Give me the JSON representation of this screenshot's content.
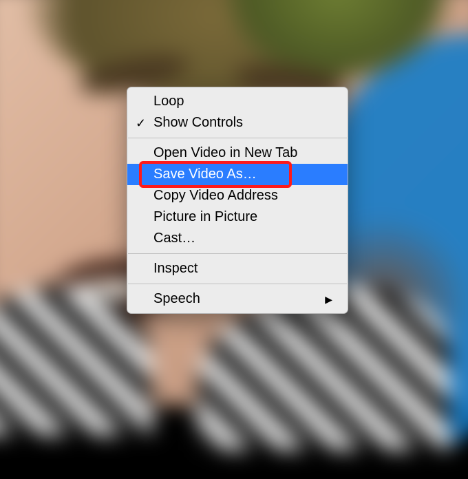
{
  "menu": {
    "items": [
      {
        "label": "Loop",
        "checked": false,
        "submenu": false
      },
      {
        "label": "Show Controls",
        "checked": true,
        "submenu": false
      },
      {
        "label": "Open Video in New Tab",
        "checked": false,
        "submenu": false
      },
      {
        "label": "Save Video As…",
        "checked": false,
        "submenu": false
      },
      {
        "label": "Copy Video Address",
        "checked": false,
        "submenu": false
      },
      {
        "label": "Picture in Picture",
        "checked": false,
        "submenu": false
      },
      {
        "label": "Cast…",
        "checked": false,
        "submenu": false
      },
      {
        "label": "Inspect",
        "checked": false,
        "submenu": false
      },
      {
        "label": "Speech",
        "checked": false,
        "submenu": true
      }
    ],
    "hovered_label": "Save Video As…",
    "separator_after_indices": [
      1,
      6,
      7
    ]
  },
  "annotation": {
    "highlighted_label": "Save Video As…"
  },
  "glyphs": {
    "check": "✓",
    "submenu": "▶"
  }
}
